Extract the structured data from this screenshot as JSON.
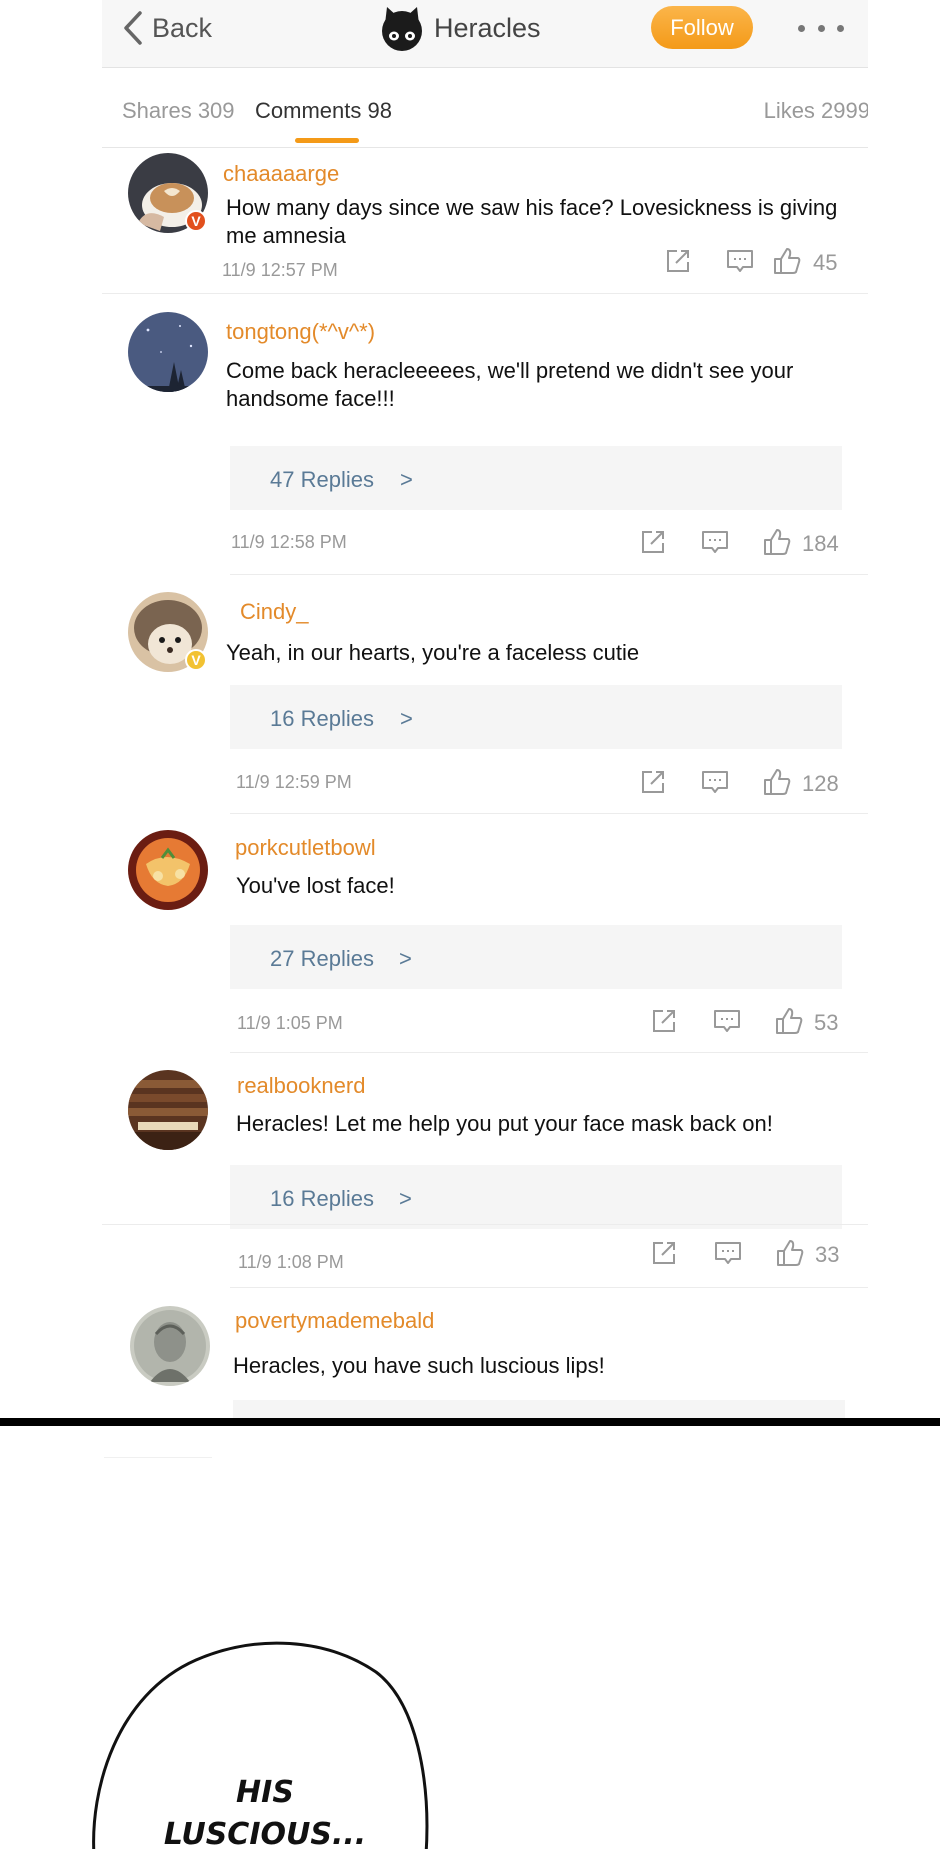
{
  "header": {
    "back_label": "Back",
    "profile_name": "Heracles",
    "follow_label": "Follow"
  },
  "tabs": {
    "shares": "Shares 309",
    "comments": "Comments 98",
    "likes": "Likes 2999"
  },
  "comments": [
    {
      "username": "chaaaaarge",
      "text": "How many days since we saw his face? Lovesickness is giving me amnesia",
      "time": "11/9 12:57 PM",
      "likes": "45",
      "badge": "V"
    },
    {
      "username": "tongtong(*^v^*)",
      "text": "Come back heracleeeees, we'll pretend we didn't see your handsome face!!!",
      "replies": "47 Replies",
      "replies_arrow": ">",
      "time": "11/9 12:58 PM",
      "likes": "184"
    },
    {
      "username": "Cindy_",
      "text": "Yeah, in our hearts, you're a faceless cutie",
      "replies": "16 Replies",
      "replies_arrow": ">",
      "time": "11/9 12:59 PM",
      "likes": "128",
      "badge": "V"
    },
    {
      "username": "porkcutletbowl",
      "text": "You've lost face!",
      "replies": "27 Replies",
      "replies_arrow": ">",
      "time": "11/9 1:05 PM",
      "likes": "53"
    },
    {
      "username": "realbooknerd",
      "text": "Heracles! Let me help you put your face mask back on!",
      "replies": "16 Replies",
      "replies_arrow": ">",
      "time": "11/9 1:08 PM",
      "likes": "33"
    },
    {
      "username": "povertymademebald",
      "text": "Heracles, you have such luscious lips!"
    }
  ],
  "panel": {
    "speech_line1": "HIS",
    "speech_line2": "LUSCIOUS..."
  },
  "colors": {
    "accent": "#f49a18",
    "username": "#e38a2a",
    "replies_link": "#5a7a96",
    "badge_red": "#e2501d",
    "badge_gold": "#f2c232"
  },
  "icons": {
    "back": "chevron-left-icon",
    "profile": "cat-avatar",
    "more": "more-dots-icon",
    "share": "share-edit-icon",
    "comment": "comment-bubble-icon",
    "like": "thumbs-up-icon"
  }
}
